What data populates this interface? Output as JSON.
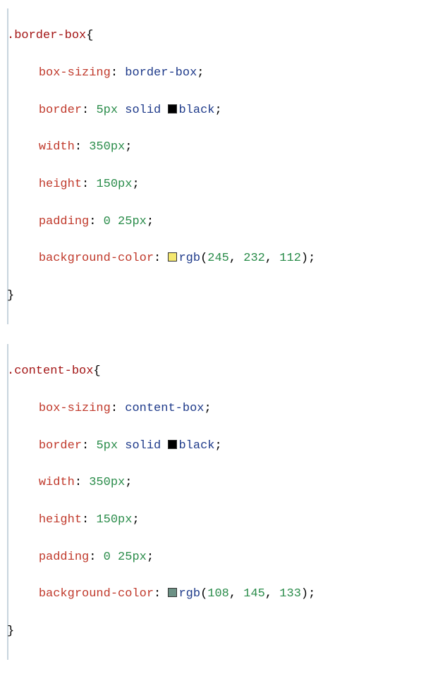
{
  "rules": [
    {
      "selector": ".border-box",
      "open": "{",
      "close": "}",
      "declarations": [
        {
          "prop": "box-sizing",
          "value_keyword": "border-box",
          "semi": ";"
        },
        {
          "prop": "border",
          "num1": "5px",
          "ident1": "solid",
          "swatch": "#000000",
          "color_name": "black",
          "semi": ";"
        },
        {
          "prop": "width",
          "num1": "350px",
          "semi": ";"
        },
        {
          "prop": "height",
          "num1": "150px",
          "semi": ";"
        },
        {
          "prop": "padding",
          "num1": "0",
          "num2": "25px",
          "semi": ";"
        },
        {
          "prop": "background-color",
          "swatch": "rgb(245,232,112)",
          "func": "rgb",
          "open_p": "(",
          "a1": "245",
          "comma1": ", ",
          "a2": "232",
          "comma2": ", ",
          "a3": "112",
          "close_p": ")",
          "semi": ";"
        }
      ]
    },
    {
      "selector": ".content-box",
      "open": "{",
      "close": "}",
      "declarations": [
        {
          "prop": "box-sizing",
          "value_keyword": "content-box",
          "semi": ";"
        },
        {
          "prop": "border",
          "num1": "5px",
          "ident1": "solid",
          "swatch": "#000000",
          "color_name": "black",
          "semi": ";"
        },
        {
          "prop": "width",
          "num1": "350px",
          "semi": ";"
        },
        {
          "prop": "height",
          "num1": "150px",
          "semi": ";"
        },
        {
          "prop": "padding",
          "num1": "0",
          "num2": "25px",
          "semi": ";"
        },
        {
          "prop": "background-color",
          "swatch": "rgb(108,145,133)",
          "func": "rgb",
          "open_p": "(",
          "a1": "108",
          "comma1": ", ",
          "a2": "145",
          "comma2": ", ",
          "a3": "133",
          "close_p": ")",
          "semi": ";"
        }
      ]
    }
  ]
}
